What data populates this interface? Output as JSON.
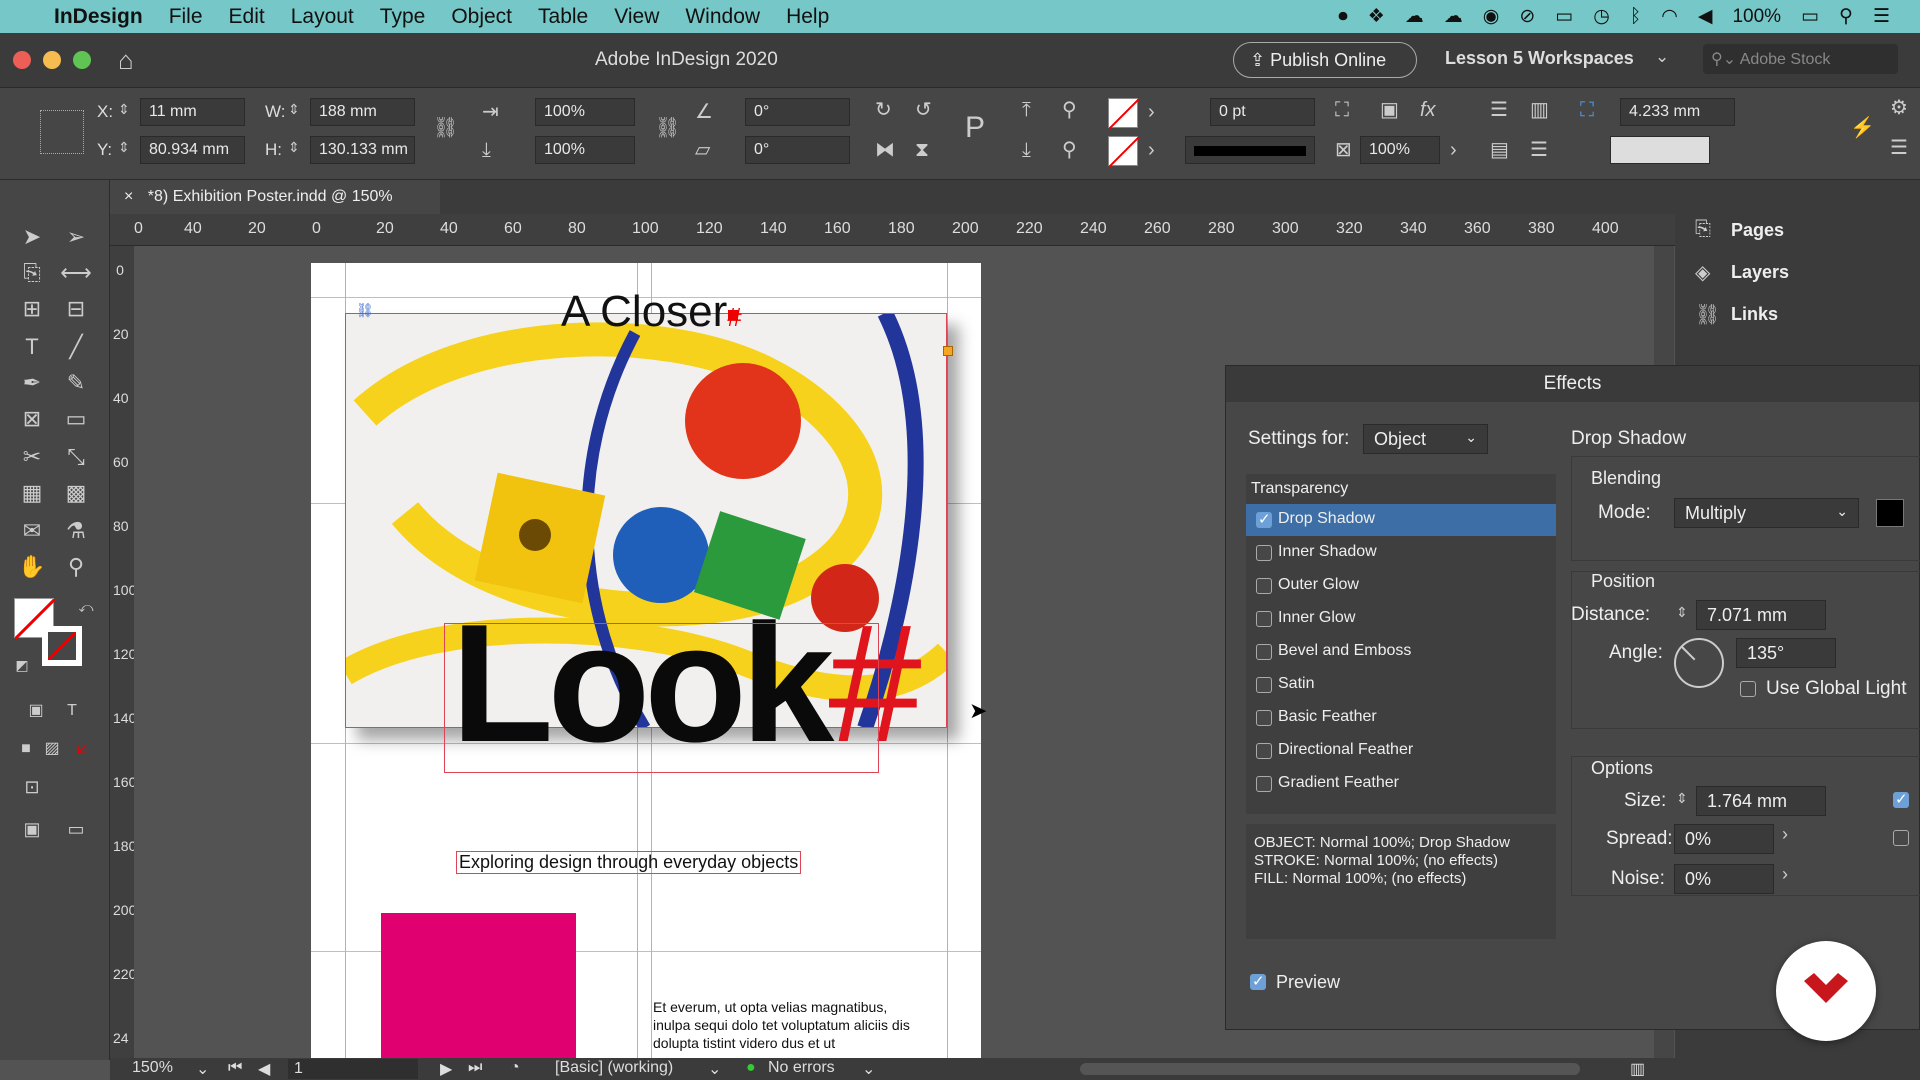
{
  "menubar": {
    "app": "InDesign",
    "items": [
      "File",
      "Edit",
      "Layout",
      "Type",
      "Object",
      "Table",
      "View",
      "Window",
      "Help"
    ],
    "battery": "100%"
  },
  "titlebar": {
    "title": "Adobe InDesign 2020",
    "publish": "Publish Online",
    "workspace": "Lesson 5 Workspaces",
    "search_placeholder": "Adobe Stock"
  },
  "control": {
    "x_label": "X:",
    "x": "11 mm",
    "y_label": "Y:",
    "y": "80.934 mm",
    "w_label": "W:",
    "w": "188 mm",
    "h_label": "H:",
    "h": "130.133 mm",
    "scale_x": "100%",
    "scale_y": "100%",
    "rotate": "0°",
    "shear": "0°",
    "stroke_weight": "0 pt",
    "opacity": "100%",
    "gap": "4.233 mm"
  },
  "doc": {
    "tab": "*8) Exhibition Poster.indd @ 150%",
    "close": "×"
  },
  "ruler": {
    "h": [
      "0",
      "40",
      "20",
      "0",
      "20",
      "40",
      "60",
      "80",
      "100",
      "120",
      "140",
      "160",
      "180",
      "200",
      "220",
      "240",
      "260",
      "280",
      "300",
      "320",
      "340",
      "360",
      "380",
      "400"
    ],
    "v": [
      "0",
      "20",
      "40",
      "60",
      "80",
      "100",
      "120",
      "140",
      "160",
      "180",
      "200",
      "220",
      "24"
    ]
  },
  "poster": {
    "title": "A Closer",
    "big": "Look",
    "hash": "#",
    "subtitle": "Exploring design through everyday objects",
    "body": "Et everum, ut opta velias magnatibus, inulpa sequi dolo tet voluptatum aliciis dis dolupta tistint videro dus et ut"
  },
  "panels": {
    "pages": "Pages",
    "layers": "Layers",
    "links": "Links"
  },
  "effects": {
    "title": "Effects",
    "settings_label": "Settings for:",
    "settings_value": "Object",
    "section": "Transparency",
    "items": [
      {
        "label": "Drop Shadow",
        "checked": true
      },
      {
        "label": "Inner Shadow",
        "checked": false
      },
      {
        "label": "Outer Glow",
        "checked": false
      },
      {
        "label": "Inner Glow",
        "checked": false
      },
      {
        "label": "Bevel and Emboss",
        "checked": false
      },
      {
        "label": "Satin",
        "checked": false
      },
      {
        "label": "Basic Feather",
        "checked": false
      },
      {
        "label": "Directional Feather",
        "checked": false
      },
      {
        "label": "Gradient Feather",
        "checked": false
      }
    ],
    "summary": [
      "OBJECT: Normal 100%; Drop Shadow",
      "STROKE: Normal 100%; (no effects)",
      "FILL: Normal 100%; (no effects)"
    ],
    "preview": "Preview",
    "panel_title": "Drop Shadow",
    "blending": "Blending",
    "mode_label": "Mode:",
    "mode": "Multiply",
    "position": "Position",
    "distance_label": "Distance:",
    "distance": "7.071 mm",
    "angle_label": "Angle:",
    "angle": "135°",
    "global_light": "Use Global Light",
    "options": "Options",
    "size_label": "Size:",
    "size": "1.764 mm",
    "spread_label": "Spread:",
    "spread": "0%",
    "noise_label": "Noise:",
    "noise": "0%"
  },
  "status": {
    "zoom": "150%",
    "page": "1",
    "preflight_profile": "[Basic] (working)",
    "errors": "No errors"
  }
}
